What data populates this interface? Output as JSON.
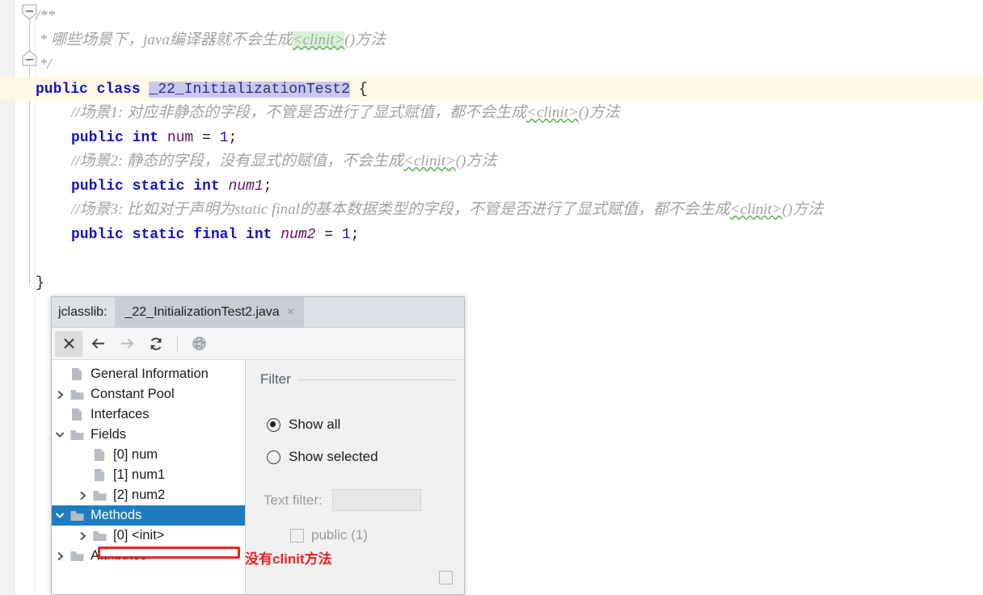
{
  "editor": {
    "lines": [
      {
        "indent": 0,
        "segments": [
          {
            "text": "/**",
            "style": "cmt"
          }
        ]
      },
      {
        "indent": 0,
        "segments": [
          {
            "text": " * 哪些场景下，java编译器就不会生成",
            "style": "cmt"
          },
          {
            "text": "<clinit>",
            "style": "cmt-green-squiggle"
          },
          {
            "text": "()方法",
            "style": "cmt"
          }
        ]
      },
      {
        "indent": 0,
        "segments": [
          {
            "text": " */",
            "style": "cmt"
          }
        ]
      },
      {
        "indent": 0,
        "highlight": true,
        "segments": [
          {
            "text": "public class ",
            "style": "kw"
          },
          {
            "text": "_22_InitializationTest2",
            "style": "clsname"
          },
          {
            "text": " {",
            "style": "plain"
          }
        ]
      },
      {
        "indent": 1,
        "segments": [
          {
            "text": "//场景1: 对应非静态的字段，不管是否进行了显式赋值，都不会生成",
            "style": "cmt"
          },
          {
            "text": "<clinit>",
            "style": "cmt-squiggle"
          },
          {
            "text": "()方法",
            "style": "cmt"
          }
        ]
      },
      {
        "indent": 1,
        "segments": [
          {
            "text": "public int ",
            "style": "kw"
          },
          {
            "text": "num",
            "style": "fld"
          },
          {
            "text": " = ",
            "style": "plain"
          },
          {
            "text": "1",
            "style": "num"
          },
          {
            "text": ";",
            "style": "plain"
          }
        ]
      },
      {
        "indent": 1,
        "segments": [
          {
            "text": "//场景2: 静态的字段，没有显式的赋值，不会生成",
            "style": "cmt"
          },
          {
            "text": "<clinit>",
            "style": "cmt-squiggle"
          },
          {
            "text": "()方法",
            "style": "cmt"
          }
        ]
      },
      {
        "indent": 1,
        "segments": [
          {
            "text": "public static int ",
            "style": "kw"
          },
          {
            "text": "num1",
            "style": "fld-i"
          },
          {
            "text": ";",
            "style": "plain"
          }
        ]
      },
      {
        "indent": 1,
        "segments": [
          {
            "text": "//场景3: 比如对于声明为static final的基本数据类型的字段，不管是否进行了显式赋值，都不会生成",
            "style": "cmt"
          },
          {
            "text": "<clinit>",
            "style": "cmt-squiggle"
          },
          {
            "text": "()方法",
            "style": "cmt"
          }
        ]
      },
      {
        "indent": 1,
        "segments": [
          {
            "text": "public static final int ",
            "style": "kw"
          },
          {
            "text": "num2",
            "style": "fld-i"
          },
          {
            "text": " = ",
            "style": "plain"
          },
          {
            "text": "1",
            "style": "num"
          },
          {
            "text": ";",
            "style": "plain"
          }
        ]
      },
      {
        "indent": 0,
        "segments": []
      },
      {
        "indent": 0,
        "segments": [
          {
            "text": "}",
            "style": "plain"
          }
        ]
      }
    ],
    "highlight_line_color": "#fefae6",
    "class_name_bg_color": "#c9c9f0",
    "clinit_highlight_color": "#d8f3d8"
  },
  "jclasslib": {
    "tab_prefix": "jclasslib:",
    "tab_title": "_22_InitializationTest2.java",
    "tab_close_icon": "×",
    "toolbar": [
      {
        "name": "close-icon",
        "glyph": "✕",
        "state": "active"
      },
      {
        "name": "back-icon",
        "glyph": "←",
        "state": "enabled"
      },
      {
        "name": "forward-icon",
        "glyph": "→",
        "state": "disabled"
      },
      {
        "name": "reload-icon",
        "glyph": "⟳",
        "state": "enabled"
      },
      {
        "name": "browse-web-icon",
        "glyph": "🌐",
        "state": "enabled"
      }
    ],
    "tree": [
      {
        "label": "General Information",
        "depth": 0,
        "icon": "file",
        "twisty": "",
        "selected": false
      },
      {
        "label": "Constant Pool",
        "depth": 0,
        "icon": "folder",
        "twisty": "collapsed",
        "selected": false
      },
      {
        "label": "Interfaces",
        "depth": 0,
        "icon": "file",
        "twisty": "",
        "selected": false
      },
      {
        "label": "Fields",
        "depth": 0,
        "icon": "folder",
        "twisty": "expanded",
        "selected": false
      },
      {
        "label": "[0] num",
        "depth": 1,
        "icon": "file",
        "twisty": "",
        "selected": false
      },
      {
        "label": "[1] num1",
        "depth": 1,
        "icon": "file",
        "twisty": "",
        "selected": false
      },
      {
        "label": "[2] num2",
        "depth": 1,
        "icon": "folder",
        "twisty": "collapsed",
        "selected": false
      },
      {
        "label": "Methods",
        "depth": 0,
        "icon": "folder",
        "twisty": "expanded",
        "selected": true
      },
      {
        "label": "[0] <init>",
        "depth": 1,
        "icon": "folder",
        "twisty": "collapsed",
        "selected": false
      },
      {
        "label": "Attributes",
        "depth": 0,
        "icon": "folder",
        "twisty": "collapsed",
        "selected": false
      }
    ],
    "filter": {
      "group_label": "Filter",
      "show_all_label": "Show all",
      "show_selected_label": "Show selected",
      "selected_option": "Show all",
      "text_filter_label": "Text filter:",
      "text_filter_value": "",
      "text_filter_placeholder": "",
      "public_checkbox_label": "public (1)",
      "public_checkbox_checked": false
    },
    "selection_color": "#1f7cc2"
  },
  "annotation": {
    "text": "没有clinit方法",
    "color": "#ef2121"
  }
}
